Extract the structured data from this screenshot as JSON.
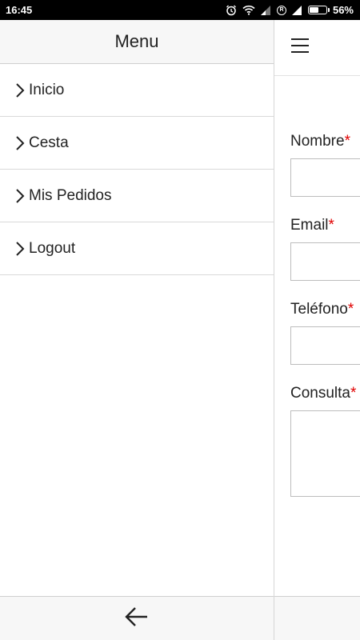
{
  "status_bar": {
    "time": "16:45",
    "battery_percent_label": "56%",
    "battery_level": 0.56,
    "icons": [
      "alarm-icon",
      "wifi-icon",
      "signal-icon",
      "registered-icon",
      "signal-icon",
      "battery-icon"
    ]
  },
  "drawer": {
    "title": "Menu",
    "items": [
      {
        "label": "Inicio",
        "icon": "chevron-right-icon"
      },
      {
        "label": "Cesta",
        "icon": "chevron-right-icon"
      },
      {
        "label": "Mis Pedidos",
        "icon": "chevron-right-icon"
      },
      {
        "label": "Logout",
        "icon": "chevron-right-icon"
      }
    ],
    "footer_icon": "arrow-left-icon"
  },
  "main": {
    "menu_icon": "hamburger-icon",
    "form": {
      "fields": [
        {
          "label": "Nombre",
          "required_mark": "*"
        },
        {
          "label": "Email",
          "required_mark": "*"
        },
        {
          "label": "Teléfono",
          "required_mark": "*"
        },
        {
          "label": "Consulta",
          "required_mark": "*"
        }
      ]
    }
  },
  "colors": {
    "required": "#e00000",
    "header_bg": "#f7f7f7",
    "text": "#222222"
  }
}
